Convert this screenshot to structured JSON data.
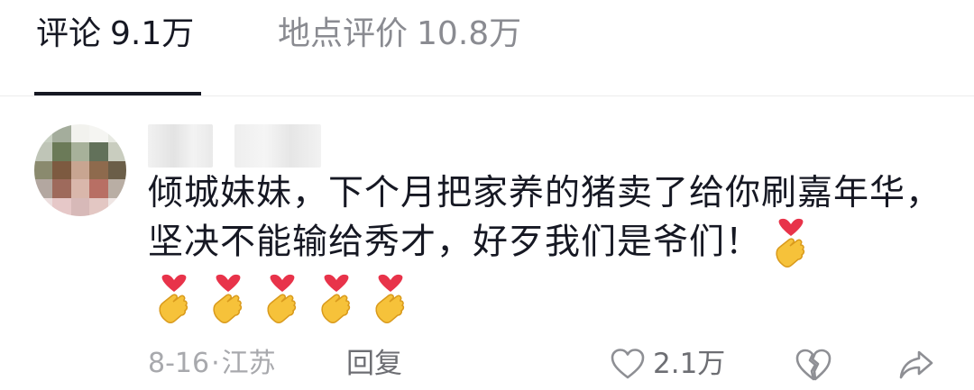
{
  "tabs": [
    {
      "label": "评论",
      "count": "9.1万",
      "active": true
    },
    {
      "label": "地点评价",
      "count": "10.8万",
      "active": false
    }
  ],
  "comment": {
    "text": "倾城妹妹，下个月把家养的猪卖了给你刷嘉年华，坚决不能输给秀才，好歹我们是爷们！",
    "emoji_icon": "heart-hands-emoji",
    "emoji_count": 6,
    "date": "8-16",
    "separator": "·",
    "location": "江苏",
    "reply_label": "回复",
    "like_count": "2.1万"
  },
  "colors": {
    "primary_text": "#161823",
    "secondary_text": "#8a8b91",
    "meta_text": "#a8a9ad",
    "action_text": "#6d6e73",
    "divider": "#ececec"
  },
  "icons": {
    "like": "heart-outline-icon",
    "dislike": "broken-heart-icon",
    "share": "share-arrow-icon"
  }
}
